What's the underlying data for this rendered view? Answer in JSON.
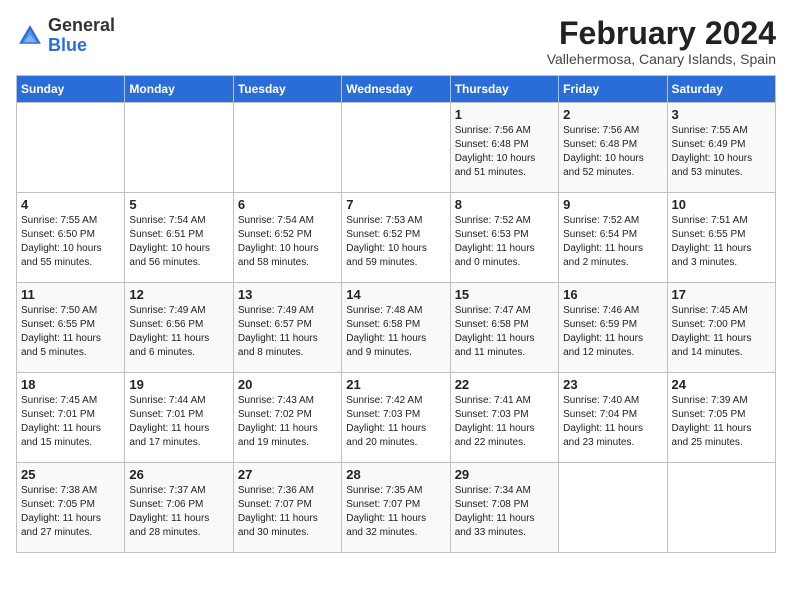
{
  "header": {
    "logo_general": "General",
    "logo_blue": "Blue",
    "month_title": "February 2024",
    "subtitle": "Vallehermosa, Canary Islands, Spain"
  },
  "days_of_week": [
    "Sunday",
    "Monday",
    "Tuesday",
    "Wednesday",
    "Thursday",
    "Friday",
    "Saturday"
  ],
  "weeks": [
    [
      {
        "day": "",
        "info": ""
      },
      {
        "day": "",
        "info": ""
      },
      {
        "day": "",
        "info": ""
      },
      {
        "day": "",
        "info": ""
      },
      {
        "day": "1",
        "info": "Sunrise: 7:56 AM\nSunset: 6:48 PM\nDaylight: 10 hours\nand 51 minutes."
      },
      {
        "day": "2",
        "info": "Sunrise: 7:56 AM\nSunset: 6:48 PM\nDaylight: 10 hours\nand 52 minutes."
      },
      {
        "day": "3",
        "info": "Sunrise: 7:55 AM\nSunset: 6:49 PM\nDaylight: 10 hours\nand 53 minutes."
      }
    ],
    [
      {
        "day": "4",
        "info": "Sunrise: 7:55 AM\nSunset: 6:50 PM\nDaylight: 10 hours\nand 55 minutes."
      },
      {
        "day": "5",
        "info": "Sunrise: 7:54 AM\nSunset: 6:51 PM\nDaylight: 10 hours\nand 56 minutes."
      },
      {
        "day": "6",
        "info": "Sunrise: 7:54 AM\nSunset: 6:52 PM\nDaylight: 10 hours\nand 58 minutes."
      },
      {
        "day": "7",
        "info": "Sunrise: 7:53 AM\nSunset: 6:52 PM\nDaylight: 10 hours\nand 59 minutes."
      },
      {
        "day": "8",
        "info": "Sunrise: 7:52 AM\nSunset: 6:53 PM\nDaylight: 11 hours\nand 0 minutes."
      },
      {
        "day": "9",
        "info": "Sunrise: 7:52 AM\nSunset: 6:54 PM\nDaylight: 11 hours\nand 2 minutes."
      },
      {
        "day": "10",
        "info": "Sunrise: 7:51 AM\nSunset: 6:55 PM\nDaylight: 11 hours\nand 3 minutes."
      }
    ],
    [
      {
        "day": "11",
        "info": "Sunrise: 7:50 AM\nSunset: 6:55 PM\nDaylight: 11 hours\nand 5 minutes."
      },
      {
        "day": "12",
        "info": "Sunrise: 7:49 AM\nSunset: 6:56 PM\nDaylight: 11 hours\nand 6 minutes."
      },
      {
        "day": "13",
        "info": "Sunrise: 7:49 AM\nSunset: 6:57 PM\nDaylight: 11 hours\nand 8 minutes."
      },
      {
        "day": "14",
        "info": "Sunrise: 7:48 AM\nSunset: 6:58 PM\nDaylight: 11 hours\nand 9 minutes."
      },
      {
        "day": "15",
        "info": "Sunrise: 7:47 AM\nSunset: 6:58 PM\nDaylight: 11 hours\nand 11 minutes."
      },
      {
        "day": "16",
        "info": "Sunrise: 7:46 AM\nSunset: 6:59 PM\nDaylight: 11 hours\nand 12 minutes."
      },
      {
        "day": "17",
        "info": "Sunrise: 7:45 AM\nSunset: 7:00 PM\nDaylight: 11 hours\nand 14 minutes."
      }
    ],
    [
      {
        "day": "18",
        "info": "Sunrise: 7:45 AM\nSunset: 7:01 PM\nDaylight: 11 hours\nand 15 minutes."
      },
      {
        "day": "19",
        "info": "Sunrise: 7:44 AM\nSunset: 7:01 PM\nDaylight: 11 hours\nand 17 minutes."
      },
      {
        "day": "20",
        "info": "Sunrise: 7:43 AM\nSunset: 7:02 PM\nDaylight: 11 hours\nand 19 minutes."
      },
      {
        "day": "21",
        "info": "Sunrise: 7:42 AM\nSunset: 7:03 PM\nDaylight: 11 hours\nand 20 minutes."
      },
      {
        "day": "22",
        "info": "Sunrise: 7:41 AM\nSunset: 7:03 PM\nDaylight: 11 hours\nand 22 minutes."
      },
      {
        "day": "23",
        "info": "Sunrise: 7:40 AM\nSunset: 7:04 PM\nDaylight: 11 hours\nand 23 minutes."
      },
      {
        "day": "24",
        "info": "Sunrise: 7:39 AM\nSunset: 7:05 PM\nDaylight: 11 hours\nand 25 minutes."
      }
    ],
    [
      {
        "day": "25",
        "info": "Sunrise: 7:38 AM\nSunset: 7:05 PM\nDaylight: 11 hours\nand 27 minutes."
      },
      {
        "day": "26",
        "info": "Sunrise: 7:37 AM\nSunset: 7:06 PM\nDaylight: 11 hours\nand 28 minutes."
      },
      {
        "day": "27",
        "info": "Sunrise: 7:36 AM\nSunset: 7:07 PM\nDaylight: 11 hours\nand 30 minutes."
      },
      {
        "day": "28",
        "info": "Sunrise: 7:35 AM\nSunset: 7:07 PM\nDaylight: 11 hours\nand 32 minutes."
      },
      {
        "day": "29",
        "info": "Sunrise: 7:34 AM\nSunset: 7:08 PM\nDaylight: 11 hours\nand 33 minutes."
      },
      {
        "day": "",
        "info": ""
      },
      {
        "day": "",
        "info": ""
      }
    ]
  ]
}
